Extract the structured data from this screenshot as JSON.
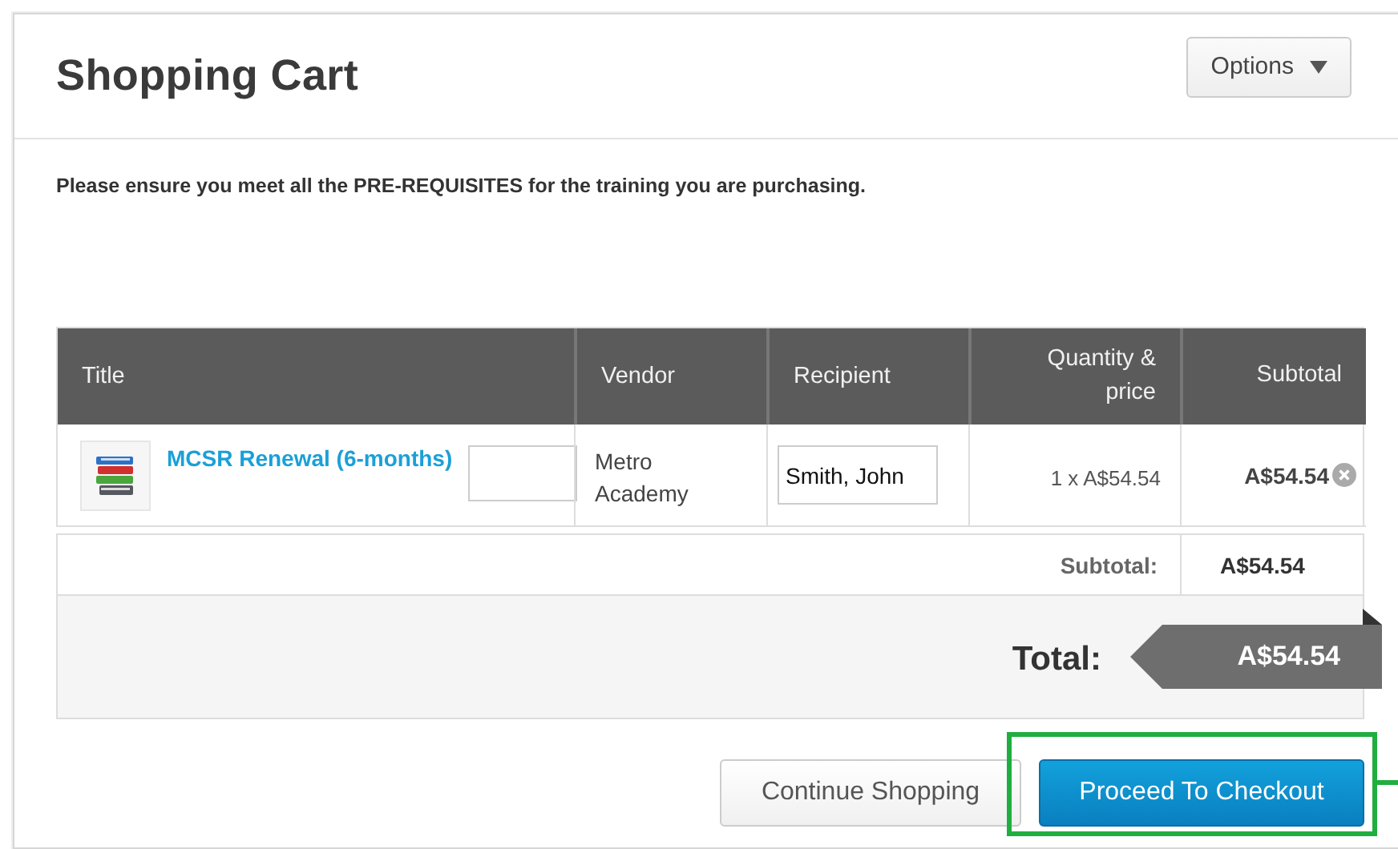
{
  "header": {
    "title": "Shopping Cart",
    "options_button": "Options"
  },
  "notice": "Please ensure you meet all the PRE-REQUISITES for the training you are purchasing.",
  "table": {
    "columns": [
      "Title",
      "Vendor",
      "Recipient",
      "Quantity & price",
      "Subtotal"
    ],
    "rows": [
      {
        "title": "MCSR Renewal (6-months)",
        "vendor": "Metro Academy",
        "recipient": "Smith, John",
        "quantity_price": "1 x A$54.54",
        "subtotal": "A$54.54"
      }
    ]
  },
  "summary": {
    "subtotal_label": "Subtotal:",
    "subtotal": "A$54.54",
    "total_label": "Total:",
    "total": "A$54.54"
  },
  "buttons": [
    {
      "label": "Continue Shopping",
      "kind": "secondary",
      "highlighted": false
    },
    {
      "label": "Proceed To Checkout",
      "kind": "primary",
      "highlighted": true
    }
  ]
}
